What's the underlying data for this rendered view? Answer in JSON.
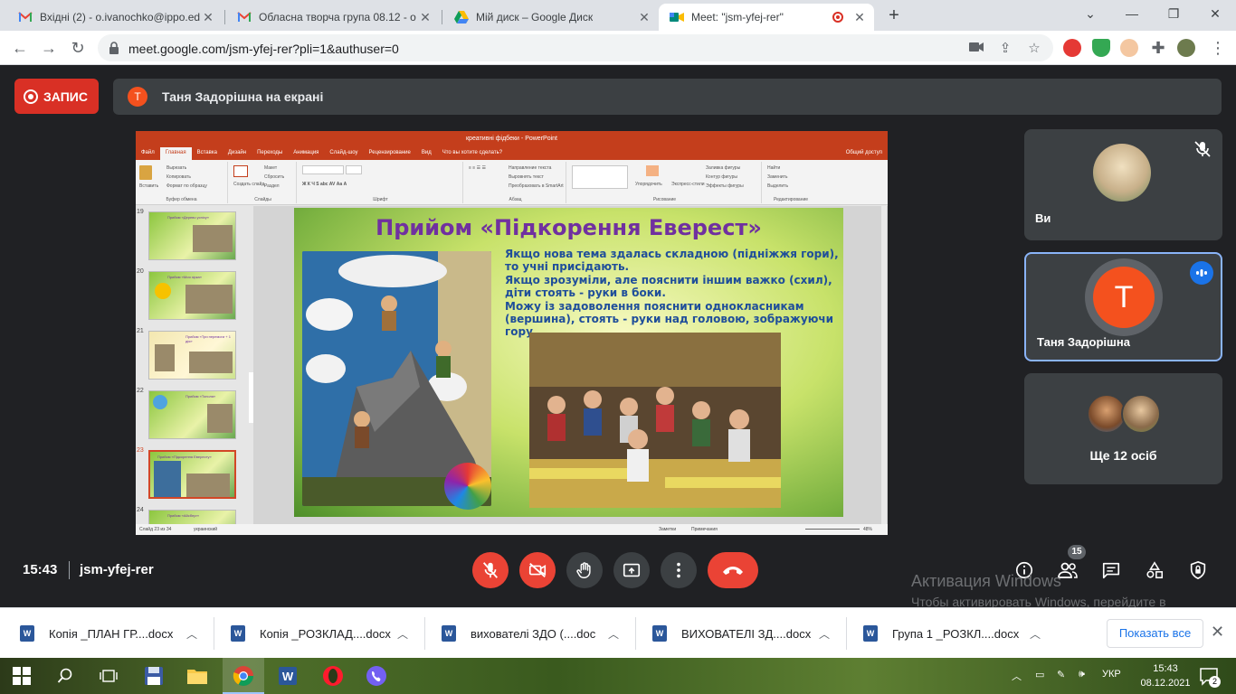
{
  "browser": {
    "tabs": [
      {
        "label": "Вхідні (2) - o.ivanochko@ippo.ed",
        "icon": "gmail-icon",
        "active": false
      },
      {
        "label": "Обласна творча група 08.12 - о",
        "icon": "gmail-icon",
        "active": false
      },
      {
        "label": "Мій диск – Google Диск",
        "icon": "google-drive-icon",
        "active": false
      },
      {
        "label": "Meet: \"jsm-yfej-rer\"",
        "icon": "google-meet-icon",
        "active": true
      }
    ],
    "url": "meet.google.com/jsm-yfej-rer?pli=1&authuser=0"
  },
  "meet": {
    "record_label": "ЗАПИС",
    "presenting_initial": "Т",
    "presenting_text": "Таня Задорішна на екрані",
    "participants": [
      {
        "name": "Ви"
      },
      {
        "name": "Таня Задорішна",
        "initial": "T"
      },
      {
        "name": "Ще 12 осіб"
      }
    ],
    "time": "15:43",
    "meeting_code": "jsm-yfej-rer",
    "participants_count": "15",
    "accent_red": "#ea4335",
    "accent_blue": "#1a73e8"
  },
  "powerpoint": {
    "window_title": "креативні фідбеки - PowerPoint",
    "tabs": [
      "Файл",
      "Главная",
      "Вставка",
      "Дизайн",
      "Переходы",
      "Анимация",
      "Слайд-шоу",
      "Рецензирование",
      "Вид",
      "Что вы хотите сделать?"
    ],
    "account_label": "Общий доступ",
    "ribbon_groups": [
      "Буфер обмена",
      "Слайды",
      "Шрифт",
      "Абзац",
      "Рисование",
      "Редактирование"
    ],
    "ribbon_items": {
      "paste": "Вставить",
      "cut": "Вырезать",
      "copy": "Копировать",
      "format_painter": "Формат по образцу",
      "new_slide": "Создать слайд",
      "layout": "Макет",
      "reset": "Сбросить",
      "section": "Раздел",
      "text_direction": "Направление текста",
      "align_text": "Выровнять текст",
      "smartart": "Преобразовать в SmartArt",
      "arrange": "Упорядочить",
      "quick_styles": "Экспресс-стили",
      "shape_fill": "Заливка фигуры",
      "shape_outline": "Контур фигуры",
      "shape_effects": "Эффекты фигуры",
      "find": "Найти",
      "replace": "Заменить",
      "select": "Выделить"
    },
    "thumbnails": [
      {
        "num": "19",
        "title": "Прийом «Дерево успіху»"
      },
      {
        "num": "20",
        "title": "Прийом «Моя зірка»"
      },
      {
        "num": "21",
        "title": "Прийом «Три перемоги + 1 дія»"
      },
      {
        "num": "22",
        "title": "Прийом «Тополя»"
      },
      {
        "num": "23",
        "title": "Прийом «Підкорення Евересту»"
      },
      {
        "num": "24",
        "title": "Прийом «Айсберг»"
      }
    ],
    "status": {
      "slide_count": "Слайд 23 из 34",
      "language": "украинский",
      "notes": "Заметки",
      "comments": "Примечания",
      "zoom": "48%"
    }
  },
  "slide": {
    "title": "Прийом «Підкорення Еверест»",
    "lines": [
      "Якщо нова тема здалась складною (підніжжя гори), то учні присідають.",
      "Якщо зрозуміли, але пояснити іншим важко (схил), діти стоять - руки в боки.",
      "Можу із задоволення пояснити однокласникам  (вершина), стоять - руки над головою, зображуючи гору."
    ],
    "title_color": "#7030a0",
    "text_color": "#1f4e9a"
  },
  "watermark": {
    "line1": "Активация Windows",
    "line2": "Чтобы активировать Windows, перейдите в раздел \"Параметры\"."
  },
  "downloads": {
    "items": [
      {
        "name": "Копія _ПЛАН ГР....docx"
      },
      {
        "name": "Копія _РОЗКЛАД....docx"
      },
      {
        "name": "вихователі ЗДО (....doc"
      },
      {
        "name": "ВИХОВАТЕЛІ ЗД....docx"
      },
      {
        "name": "Група 1 _РОЗКЛ....docx"
      }
    ],
    "show_all": "Показать все"
  },
  "taskbar": {
    "language": "УКР",
    "time": "15:43",
    "date": "08.12.2021",
    "notifications": "2"
  }
}
